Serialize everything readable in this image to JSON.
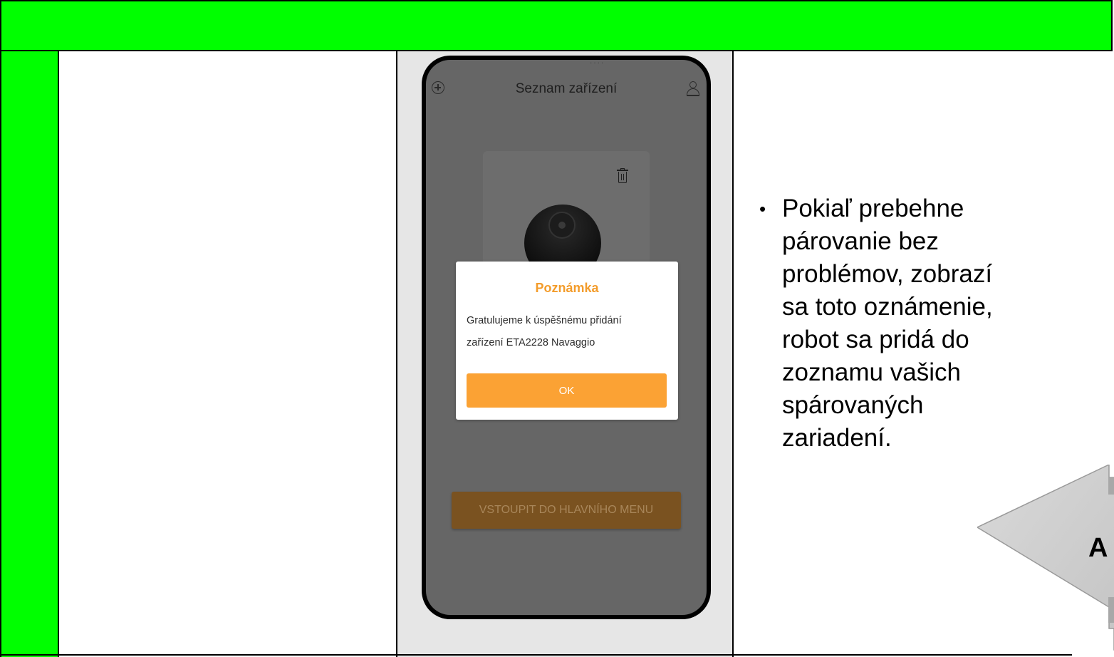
{
  "phone": {
    "status_bar": "....",
    "header": {
      "title": "Seznam zařízení",
      "left_icon": "plus-circle-icon",
      "right_icon": "user-icon"
    },
    "device_card": {
      "delete_icon": "trash-icon",
      "image": "robot-vacuum"
    },
    "main_menu_button": "VSTOUPIT DO HLAVNÍHO MENU",
    "dialog": {
      "title": "Poznámka",
      "message_line1": "Gratulujeme k úspěšnému přidání",
      "message_line2": "zařízení ETA2228 Navaggio",
      "ok_label": "OK"
    }
  },
  "description": {
    "bullet": "•",
    "lines": [
      "Pokiaľ prebehne",
      "párovanie bez",
      "problémov, zobrazí",
      "sa toto oznámenie,",
      "robot sa pridá do",
      "zoznamu vašich",
      "spárovaných",
      "zariadení."
    ]
  },
  "arrow": {
    "label": "A"
  },
  "colors": {
    "band": "#00ff00",
    "accent": "#fba234",
    "dialog_title": "#f39c2b",
    "overlay": "#666666"
  }
}
